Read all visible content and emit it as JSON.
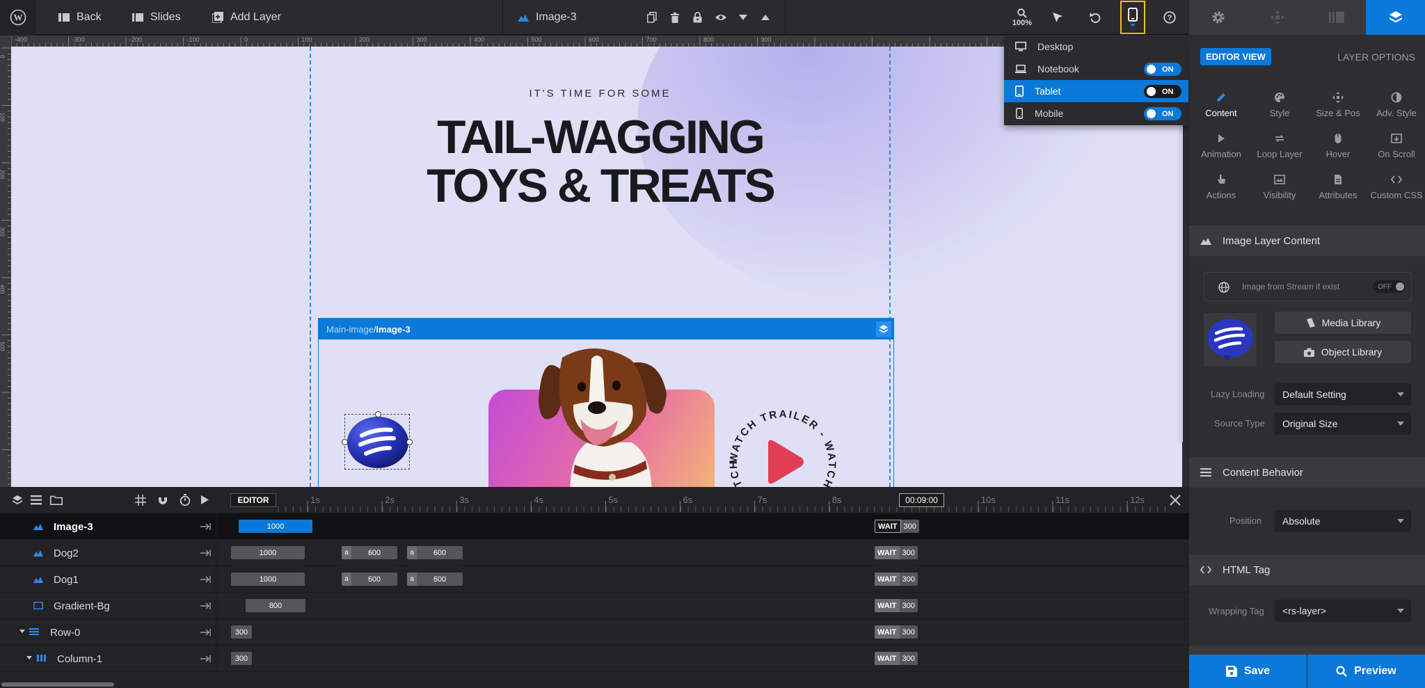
{
  "toolbar": {
    "back": "Back",
    "slides": "Slides",
    "add_layer": "Add Layer",
    "layer_name": "Image-3",
    "zoom": "100%"
  },
  "device_menu": {
    "items": [
      {
        "label": "Desktop",
        "toggle": ""
      },
      {
        "label": "Notebook",
        "toggle": "ON"
      },
      {
        "label": "Tablet",
        "toggle": "ON"
      },
      {
        "label": "Mobile",
        "toggle": "ON"
      }
    ],
    "active": "Tablet"
  },
  "ruler": {
    "top": [
      "-400",
      "-300",
      "-200",
      "-100",
      "0",
      "100",
      "200",
      "300",
      "400",
      "500",
      "600",
      "700",
      "800",
      "900"
    ],
    "left": [
      "0",
      "100",
      "200",
      "300",
      "400",
      "500"
    ]
  },
  "slide": {
    "eyebrow": "IT'S TIME FOR SOME",
    "headline_1": "TAIL-WAGGING",
    "headline_2": "TOYS & TREATS",
    "breadcrumb_parent": "Main-image",
    "breadcrumb_sep": " / ",
    "breadcrumb_current": "Image-3",
    "circle_text": "WATCH TRAILER - WATCH TRAILER - WATCH TRAILER - "
  },
  "right_panel": {
    "editor_view": "EDITOR VIEW",
    "layer_options": "LAYER OPTIONS",
    "options": [
      {
        "label": "Content",
        "icon": "pen-icon"
      },
      {
        "label": "Style",
        "icon": "palette-icon"
      },
      {
        "label": "Size & Pos",
        "icon": "move-icon"
      },
      {
        "label": "Adv. Style",
        "icon": "contrast-icon"
      },
      {
        "label": "Animation",
        "icon": "play-icon"
      },
      {
        "label": "Loop Layer",
        "icon": "loop-icon"
      },
      {
        "label": "Hover",
        "icon": "mouse-icon"
      },
      {
        "label": "On Scroll",
        "icon": "scroll-icon"
      },
      {
        "label": "Actions",
        "icon": "hand-icon"
      },
      {
        "label": "Visibility",
        "icon": "visibility-icon"
      },
      {
        "label": "Attributes",
        "icon": "document-icon"
      },
      {
        "label": "Custom CSS",
        "icon": "code-icon"
      }
    ],
    "image_layer_content": "Image Layer Content",
    "stream_label": "Image from Stream if exist",
    "stream_toggle": "OFF",
    "media_library": "Media Library",
    "object_library": "Object Library",
    "lazy_loading_label": "Lazy Loading",
    "lazy_loading_value": "Default Setting",
    "source_type_label": "Source Type",
    "source_type_value": "Original Size",
    "content_behavior": "Content Behavior",
    "position_label": "Position",
    "position_value": "Absolute",
    "html_tag": "HTML Tag",
    "wrapping_tag_label": "Wrapping Tag",
    "wrapping_tag_value": "<rs-layer>",
    "save": "Save",
    "preview": "Preview"
  },
  "timeline": {
    "editor": "EDITOR",
    "time": "00:09:00",
    "ticks": [
      "1s",
      "2s",
      "3s",
      "4s",
      "5s",
      "6s",
      "7s",
      "8s",
      "10s",
      "11s",
      "12s"
    ],
    "wait": "WAIT",
    "rows": [
      {
        "name": "Image-3",
        "bars": [
          "1000"
        ],
        "end": "300"
      },
      {
        "name": "Dog2",
        "bars": [
          "1000",
          "600",
          "600"
        ],
        "end": "300"
      },
      {
        "name": "Dog1",
        "bars": [
          "1000",
          "600",
          "600"
        ],
        "end": "300"
      },
      {
        "name": "Gradient-Bg",
        "bars": [
          "800"
        ],
        "end": "300"
      },
      {
        "name": "Row-0",
        "bars": [
          "300"
        ],
        "end": "300"
      },
      {
        "name": "Column-1",
        "bars": [
          "300"
        ],
        "end": "300"
      }
    ],
    "anim_marker": "a"
  },
  "colors": {
    "accent": "#0a79d9",
    "stage_bg": "#dfe0f6",
    "panel_bg": "#2e2e31",
    "highlight_box": "#f3c21a"
  }
}
